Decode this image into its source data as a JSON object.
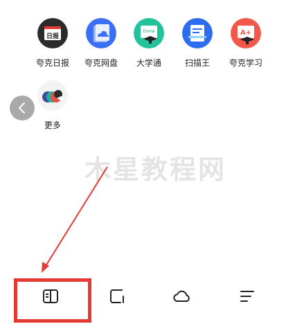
{
  "apps": [
    {
      "label": "夸克日报",
      "icon": "daily-news-icon",
      "badge_text": "日报"
    },
    {
      "label": "夸克网盘",
      "icon": "cloud-drive-icon"
    },
    {
      "label": "大学通",
      "icon": "university-icon",
      "badge_text": "Exme"
    },
    {
      "label": "扫描王",
      "icon": "scanner-icon"
    },
    {
      "label": "夸克学习",
      "icon": "study-icon",
      "badge_text": "A+"
    }
  ],
  "more": {
    "label": "更多",
    "icon": "more-apps-icon"
  },
  "watermark": "木星教程网",
  "bottom_tabs": [
    {
      "name": "read",
      "icon": "book-icon",
      "selected": true
    },
    {
      "name": "tabs",
      "icon": "tabs-icon"
    },
    {
      "name": "cloud",
      "icon": "cloud-icon"
    },
    {
      "name": "menu",
      "icon": "menu-icon"
    }
  ],
  "colors": {
    "highlight": "#e53935",
    "icon_stroke": "#222222",
    "back_button": "#a9a9a9"
  }
}
